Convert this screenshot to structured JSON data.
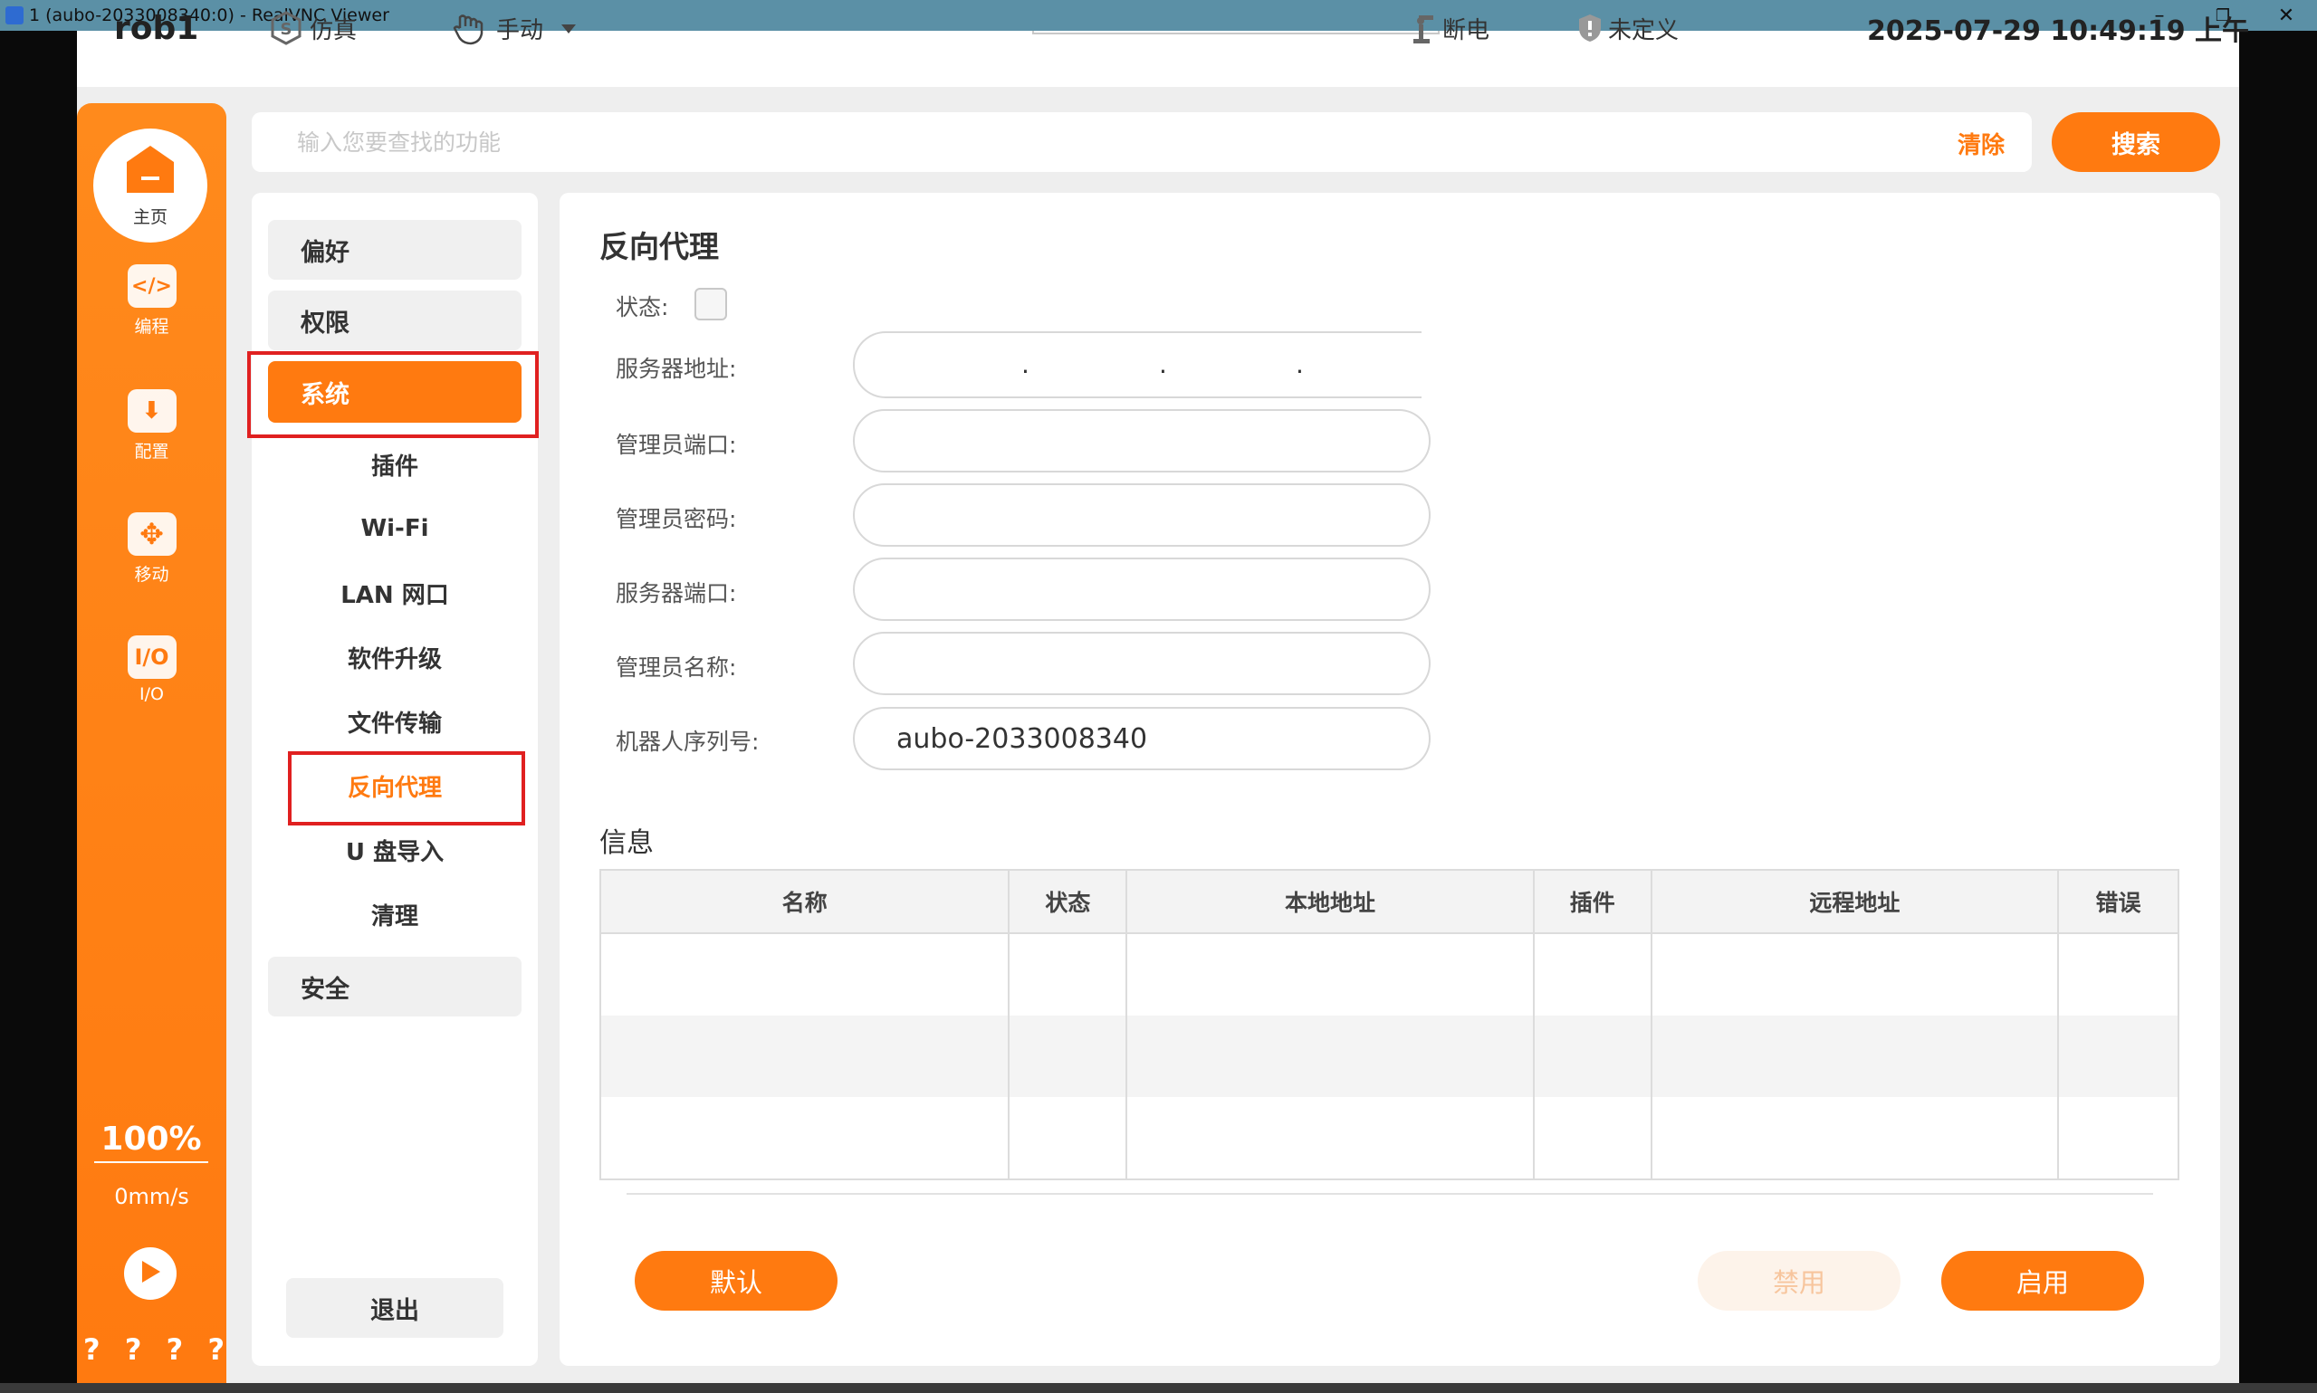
{
  "window": {
    "title": "1 (aubo-2033008340:0) - RealVNC Viewer",
    "minimize_glyph": "–",
    "restore_glyph": "❐",
    "close_glyph": "✕"
  },
  "topbar": {
    "robot_name": "rob1",
    "simulation_label": "仿真",
    "mode_label": "手动",
    "power_label": "断电",
    "safety_label": "未定义",
    "datetime": "2025-07-29 10:49:19 上午"
  },
  "sidebar": {
    "home_label": "主页",
    "items": [
      {
        "label": "编程",
        "icon": "code-icon",
        "glyph": "</>"
      },
      {
        "label": "配置",
        "icon": "download-icon",
        "glyph": "⬇"
      },
      {
        "label": "移动",
        "icon": "move-icon",
        "glyph": "✥"
      },
      {
        "label": "I/O",
        "icon": "io-icon",
        "glyph": "I/O"
      }
    ],
    "speed_percent": "100%",
    "speed_value": "0mm/s",
    "help_glyphs": [
      "?",
      "?",
      "?",
      "?"
    ]
  },
  "search": {
    "placeholder": "输入您要查找的功能",
    "clear_label": "清除",
    "search_label": "搜索"
  },
  "nav": {
    "preferences": "偏好",
    "permissions": "权限",
    "system": "系统",
    "system_sub": [
      {
        "label": "插件",
        "name": "nav-sub-plugins"
      },
      {
        "label": "Wi-Fi",
        "name": "nav-sub-wifi"
      },
      {
        "label": "LAN 网口",
        "name": "nav-sub-lan"
      },
      {
        "label": "软件升级",
        "name": "nav-sub-software-upgrade"
      },
      {
        "label": "文件传输",
        "name": "nav-sub-file-transfer"
      },
      {
        "label": "反向代理",
        "name": "nav-sub-reverse-proxy"
      },
      {
        "label": "U 盘导入",
        "name": "nav-sub-usb-import"
      },
      {
        "label": "清理",
        "name": "nav-sub-cleanup"
      }
    ],
    "security": "安全",
    "exit": "退出"
  },
  "content": {
    "title": "反向代理",
    "status_label": "状态:",
    "fields": {
      "server_address_label": "服务器地址:",
      "admin_port_label": "管理员端口:",
      "admin_password_label": "管理员密码:",
      "server_port_label": "服务器端口:",
      "admin_name_label": "管理员名称:",
      "serial_label": "机器人序列号:",
      "serial_value": "aubo-2033008340",
      "ip_dots": [
        ".",
        ".",
        "."
      ]
    },
    "info_title": "信息",
    "table_headers": [
      "名称",
      "状态",
      "本地地址",
      "插件",
      "远程地址",
      "错误"
    ],
    "buttons": {
      "default": "默认",
      "disable": "禁用",
      "enable": "启用"
    }
  },
  "colors": {
    "accent": "#ff7a10",
    "highlight_border": "#e02020",
    "disabled_text": "#f7c59d",
    "disabled_bg": "#fdf3ea"
  }
}
